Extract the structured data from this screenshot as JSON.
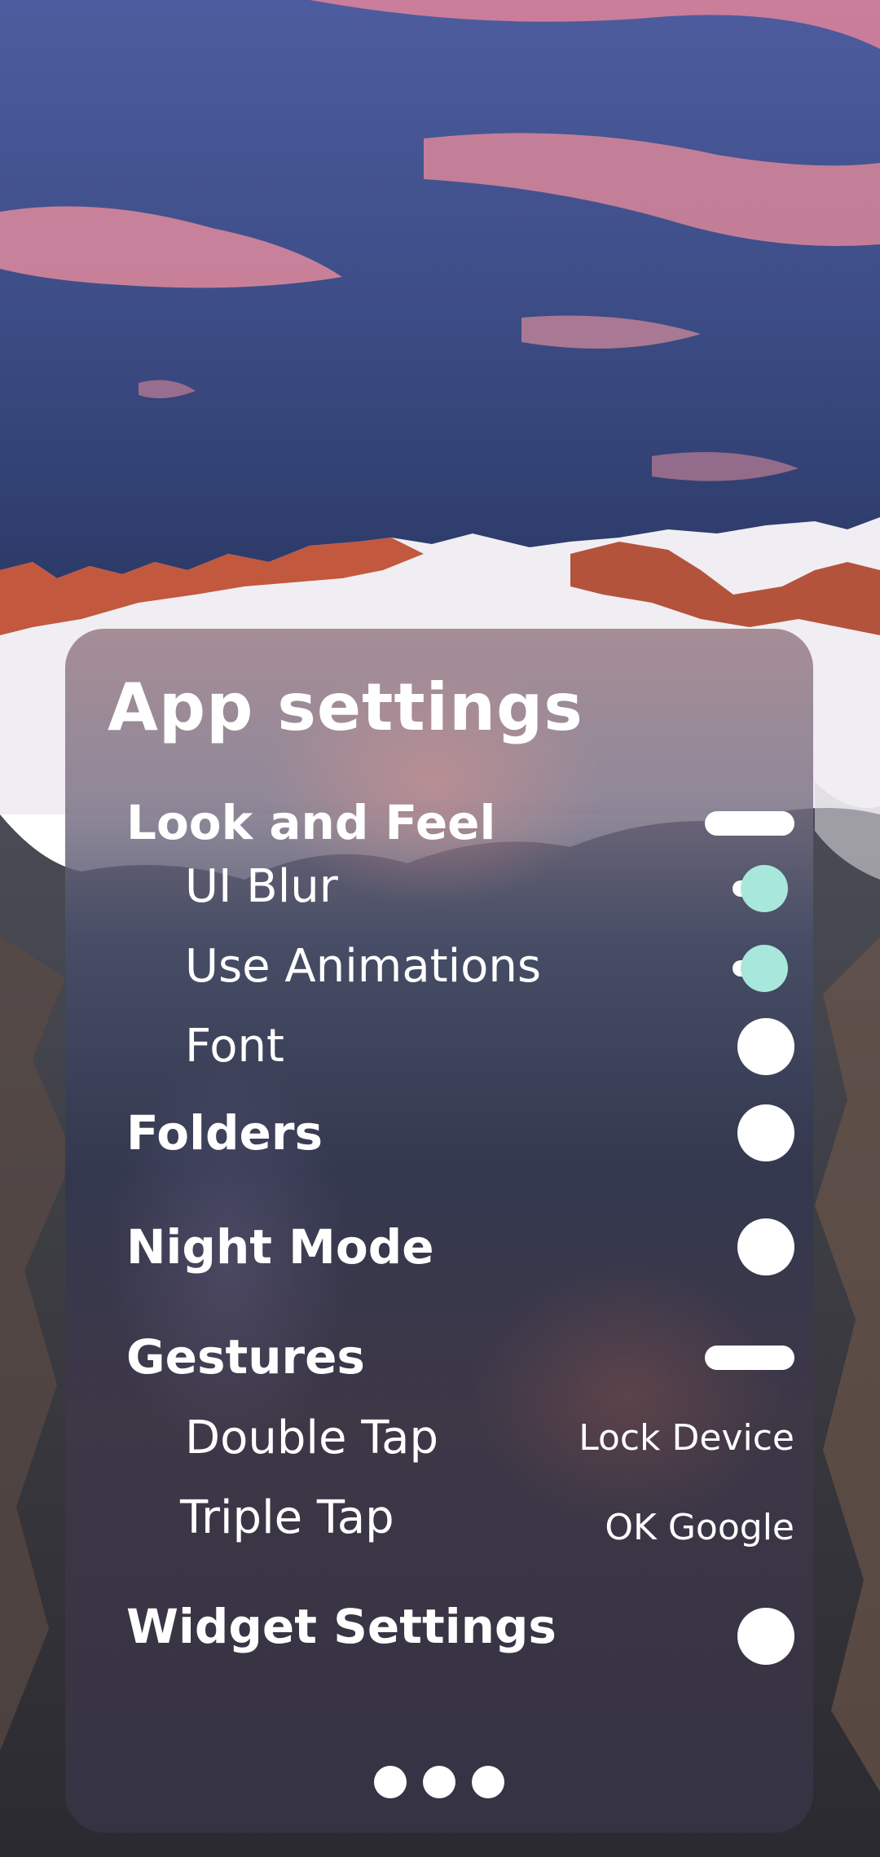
{
  "settings": {
    "title": "App settings",
    "accent_color": "#a8e8dc",
    "sections": {
      "look_and_feel": {
        "label": "Look and Feel",
        "control": "collapse-bar",
        "items": {
          "ui_blur": {
            "label": "UI Blur",
            "enabled": true
          },
          "use_animations": {
            "label": "Use Animations",
            "enabled": true
          },
          "font": {
            "label": "Font",
            "control": "expand-circle"
          }
        }
      },
      "folders": {
        "label": "Folders",
        "control": "expand-circle"
      },
      "night_mode": {
        "label": "Night Mode",
        "control": "expand-circle"
      },
      "gestures": {
        "label": "Gestures",
        "control": "collapse-bar",
        "items": {
          "double_tap": {
            "label": "Double Tap",
            "value": "Lock Device"
          },
          "triple_tap": {
            "label": "Triple Tap",
            "value": "OK Google"
          }
        }
      },
      "widget_settings": {
        "label": "Widget Settings",
        "control": "expand-circle"
      }
    },
    "page_indicator": {
      "count": 3
    }
  }
}
